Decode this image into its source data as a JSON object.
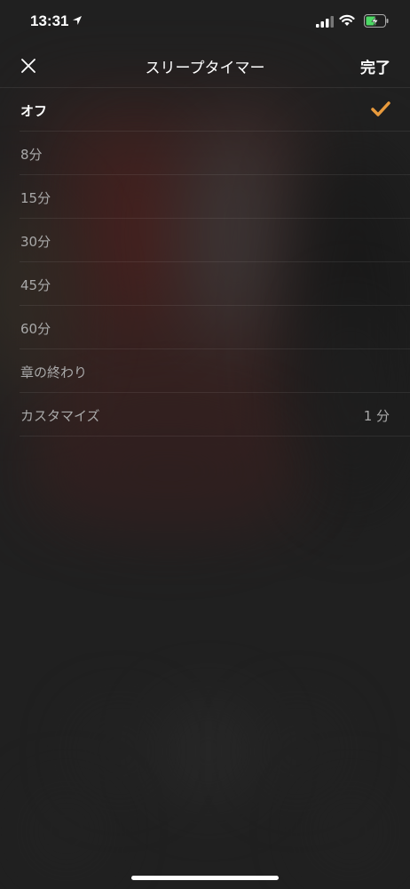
{
  "status_bar": {
    "time": "13:31",
    "location_icon": "location-arrow-icon",
    "signal_icon": "cellular-signal-icon",
    "wifi_icon": "wifi-icon",
    "battery_icon": "battery-charging-icon"
  },
  "nav": {
    "close_icon": "close-icon",
    "title": "スリープタイマー",
    "done_label": "完了"
  },
  "timer_options": [
    {
      "label": "オフ",
      "selected": true
    },
    {
      "label": "8分",
      "selected": false
    },
    {
      "label": "15分",
      "selected": false
    },
    {
      "label": "30分",
      "selected": false
    },
    {
      "label": "45分",
      "selected": false
    },
    {
      "label": "60分",
      "selected": false
    },
    {
      "label": "章の終わり",
      "selected": false
    },
    {
      "label": "カスタマイズ",
      "selected": false,
      "value": "1 分"
    }
  ],
  "colors": {
    "accent": "#e89a3c",
    "text_primary": "#ffffff",
    "text_secondary": "#a9a9a9"
  }
}
